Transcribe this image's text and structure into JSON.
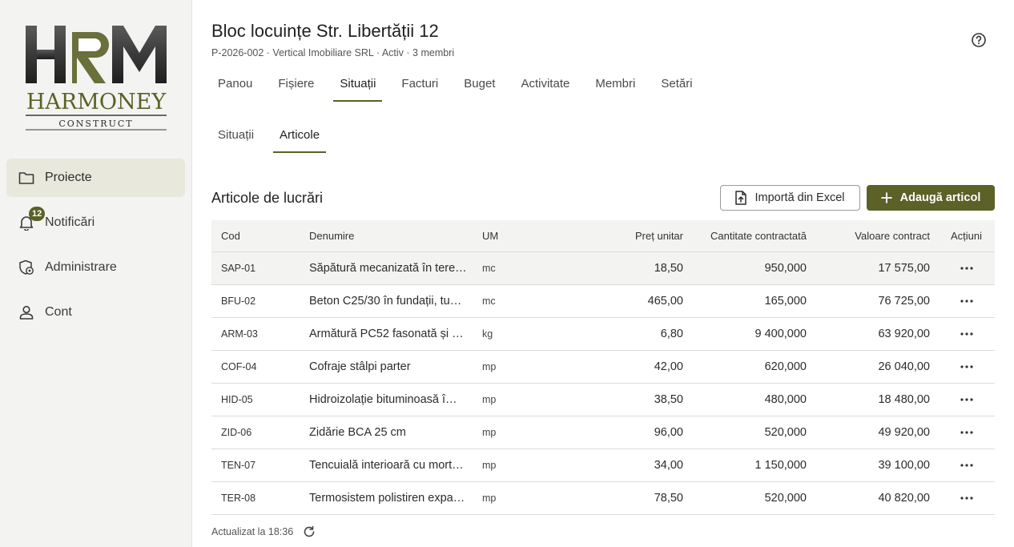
{
  "sidebar": {
    "logo": {
      "text": "HARMONEY",
      "subtext": "CONSTRUCT",
      "mono": "HRM"
    },
    "items": [
      {
        "label": "Proiecte",
        "icon": "folder-icon",
        "active": true
      },
      {
        "label": "Notificări",
        "icon": "bell-icon",
        "badge": "12"
      },
      {
        "label": "Administrare",
        "icon": "shield-gear-icon"
      },
      {
        "label": "Cont",
        "icon": "user-icon"
      }
    ]
  },
  "header": {
    "title": "Bloc locuințe Str. Libertății 12",
    "subtitle": "P-2026-002 · Vertical Imobiliare SRL · Activ · 3 membri"
  },
  "tabs": [
    "Panou",
    "Fișiere",
    "Situații",
    "Facturi",
    "Buget",
    "Activitate",
    "Membri",
    "Setări"
  ],
  "active_tab": "Situații",
  "subtabs": [
    "Situații",
    "Articole"
  ],
  "active_subtab": "Articole",
  "section": {
    "title": "Articole de lucrări",
    "import_label": "Importă din Excel",
    "add_label": "Adaugă articol"
  },
  "table": {
    "columns": [
      "Cod",
      "Denumire",
      "UM",
      "Preț unitar",
      "Cantitate contractată",
      "Valoare contract",
      "Acțiuni"
    ],
    "rows": [
      {
        "cod": "SAP-01",
        "denumire": "Săpătură mecanizată în tere…",
        "um": "mc",
        "pret": "18,50",
        "cant": "950,000",
        "val": "17 575,00"
      },
      {
        "cod": "BFU-02",
        "denumire": "Beton C25/30 în fundații, tu…",
        "um": "mc",
        "pret": "465,00",
        "cant": "165,000",
        "val": "76 725,00"
      },
      {
        "cod": "ARM-03",
        "denumire": "Armătură PC52 fasonată și …",
        "um": "kg",
        "pret": "6,80",
        "cant": "9 400,000",
        "val": "63 920,00"
      },
      {
        "cod": "COF-04",
        "denumire": "Cofraje stâlpi parter",
        "um": "mp",
        "pret": "42,00",
        "cant": "620,000",
        "val": "26 040,00"
      },
      {
        "cod": "HID-05",
        "denumire": "Hidroizolație bituminoasă î…",
        "um": "mp",
        "pret": "38,50",
        "cant": "480,000",
        "val": "18 480,00"
      },
      {
        "cod": "ZID-06",
        "denumire": "Zidărie BCA 25 cm",
        "um": "mp",
        "pret": "96,00",
        "cant": "520,000",
        "val": "49 920,00"
      },
      {
        "cod": "TEN-07",
        "denumire": "Tencuială interioară cu mort…",
        "um": "mp",
        "pret": "34,00",
        "cant": "1 150,000",
        "val": "39 100,00"
      },
      {
        "cod": "TER-08",
        "denumire": "Termosistem polistiren expa…",
        "um": "mp",
        "pret": "78,50",
        "cant": "520,000",
        "val": "40 820,00"
      }
    ]
  },
  "footer": {
    "updated": "Actualizat la 18:36"
  },
  "colors": {
    "accent": "#5b6127",
    "sidebar_bg": "#f3f3f1",
    "active_nav": "#e8e9dc"
  }
}
